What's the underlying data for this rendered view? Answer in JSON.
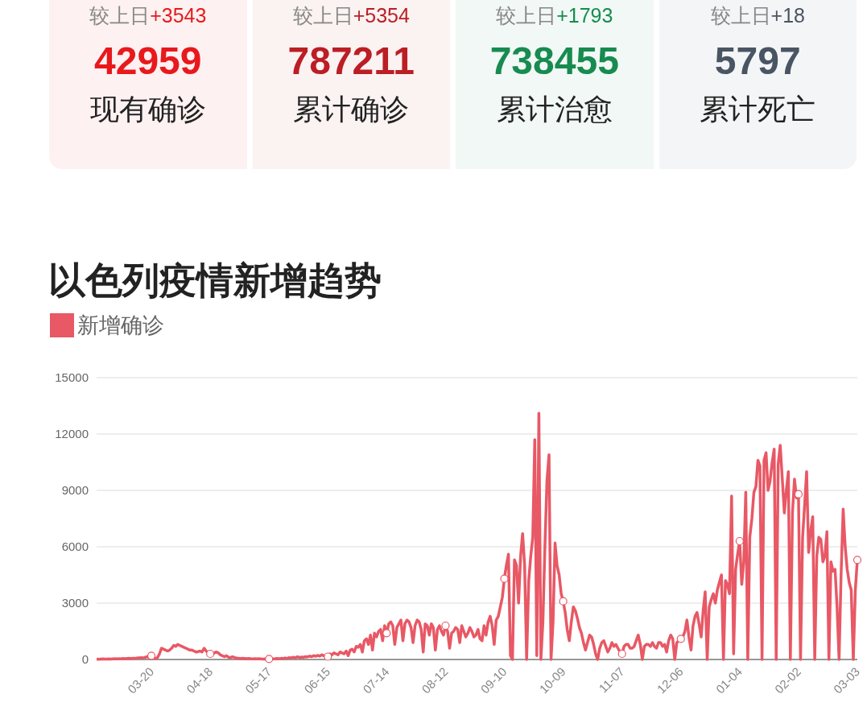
{
  "stats": [
    {
      "change_label": "较上日",
      "change": "+3543",
      "value": "42959",
      "label": "现有确诊",
      "color": "#e8191c"
    },
    {
      "change_label": "较上日",
      "change": "+5354",
      "value": "787211",
      "label": "累计确诊",
      "color": "#bb1e24"
    },
    {
      "change_label": "较上日",
      "change": "+1793",
      "value": "738455",
      "label": "累计治愈",
      "color": "#178b50"
    },
    {
      "change_label": "较上日",
      "change": "+18",
      "value": "5797",
      "label": "累计死亡",
      "color": "#4a5563"
    }
  ],
  "trend": {
    "title": "以色列疫情新增趋势",
    "chart_data": {
      "type": "line",
      "categories": [
        null,
        null,
        null,
        null,
        null,
        null,
        null,
        null,
        null,
        null,
        null,
        null,
        null,
        null,
        null,
        null,
        null,
        null,
        null,
        null,
        null,
        null,
        null,
        null,
        null,
        null,
        null,
        "03-20",
        null,
        null,
        null,
        null,
        null,
        null,
        null,
        null,
        null,
        null,
        null,
        null,
        null,
        null,
        null,
        null,
        null,
        null,
        null,
        null,
        null,
        null,
        null,
        null,
        null,
        null,
        null,
        null,
        "04-18",
        null,
        null,
        null,
        null,
        null,
        null,
        null,
        null,
        null,
        null,
        null,
        null,
        null,
        null,
        null,
        null,
        null,
        null,
        null,
        null,
        null,
        null,
        null,
        null,
        null,
        null,
        null,
        null,
        "05-17",
        null,
        null,
        null,
        null,
        null,
        null,
        null,
        null,
        null,
        null,
        null,
        null,
        null,
        null,
        null,
        null,
        null,
        null,
        null,
        null,
        null,
        null,
        null,
        null,
        null,
        null,
        null,
        null,
        "06-15",
        null,
        null,
        null,
        null,
        null,
        null,
        null,
        null,
        null,
        null,
        null,
        null,
        null,
        null,
        null,
        null,
        null,
        null,
        null,
        null,
        null,
        null,
        null,
        null,
        null,
        null,
        null,
        null,
        "07-14",
        null,
        null,
        null,
        null,
        null,
        null,
        null,
        null,
        null,
        null,
        null,
        null,
        null,
        null,
        null,
        null,
        null,
        null,
        null,
        null,
        null,
        null,
        null,
        null,
        null,
        null,
        null,
        null,
        "08-12",
        null,
        null,
        null,
        null,
        null,
        null,
        null,
        null,
        null,
        null,
        null,
        null,
        null,
        null,
        null,
        null,
        null,
        null,
        null,
        null,
        null,
        null,
        null,
        null,
        null,
        null,
        null,
        null,
        "09-10",
        null,
        null,
        null,
        null,
        null,
        null,
        null,
        null,
        null,
        null,
        null,
        null,
        null,
        null,
        null,
        null,
        null,
        null,
        null,
        null,
        null,
        null,
        null,
        null,
        null,
        null,
        null,
        null,
        "10-09",
        null,
        null,
        null,
        null,
        null,
        null,
        null,
        null,
        null,
        null,
        null,
        null,
        null,
        null,
        null,
        null,
        null,
        null,
        null,
        null,
        null,
        null,
        null,
        null,
        null,
        null,
        null,
        null,
        "11-07",
        null,
        null,
        null,
        null,
        null,
        null,
        null,
        null,
        null,
        null,
        null,
        null,
        null,
        null,
        null,
        null,
        null,
        null,
        null,
        null,
        null,
        null,
        null,
        null,
        null,
        null,
        null,
        null,
        "12-06",
        null,
        null,
        null,
        null,
        null,
        null,
        null,
        null,
        null,
        null,
        null,
        null,
        null,
        null,
        null,
        null,
        null,
        null,
        null,
        null,
        null,
        null,
        null,
        null,
        null,
        null,
        null,
        null,
        "01-04",
        null,
        null,
        null,
        null,
        null,
        null,
        null,
        null,
        null,
        null,
        null,
        null,
        null,
        null,
        null,
        null,
        null,
        null,
        null,
        null,
        null,
        null,
        null,
        null,
        null,
        null,
        null,
        null,
        "02-02",
        null,
        null,
        null,
        null,
        null,
        null,
        null,
        null,
        null,
        null,
        null,
        null,
        null,
        null,
        null,
        null,
        null,
        null,
        null,
        null,
        null,
        null,
        null,
        null,
        null,
        null,
        null,
        null,
        "03-03"
      ],
      "series": [
        {
          "name": "新增确诊",
          "color": "#e85865",
          "values": [
            20,
            10,
            20,
            30,
            20,
            20,
            30,
            20,
            30,
            40,
            30,
            40,
            30,
            50,
            40,
            50,
            60,
            50,
            70,
            60,
            80,
            90,
            100,
            80,
            120,
            150,
            100,
            200,
            100,
            50,
            100,
            300,
            600,
            550,
            500,
            450,
            500,
            600,
            750,
            700,
            800,
            750,
            700,
            650,
            600,
            550,
            500,
            500,
            450,
            400,
            420,
            450,
            400,
            600,
            450,
            350,
            300,
            300,
            350,
            400,
            350,
            250,
            200,
            150,
            200,
            120,
            100,
            150,
            100,
            80,
            60,
            50,
            60,
            50,
            40,
            50,
            40,
            30,
            40,
            30,
            40,
            30,
            20,
            30,
            20,
            30,
            20,
            30,
            40,
            50,
            40,
            60,
            50,
            80,
            60,
            100,
            80,
            120,
            90,
            150,
            100,
            130,
            120,
            150,
            140,
            180,
            150,
            200,
            170,
            220,
            180,
            250,
            200,
            180,
            150,
            300,
            250,
            350,
            300,
            250,
            400,
            350,
            300,
            450,
            200,
            500,
            550,
            400,
            700,
            650,
            800,
            400,
            1000,
            1100,
            800,
            1300,
            500,
            1400,
            1200,
            1500,
            1600,
            1000,
            1800,
            1400,
            1900,
            2000,
            1800,
            800,
            1700,
            1900,
            2100,
            1000,
            1900,
            2100,
            2000,
            1700,
            900,
            1800,
            2100,
            2000,
            1600,
            400,
            1900,
            1800,
            1300,
            1900,
            1700,
            500,
            1600,
            1800,
            1500,
            1300,
            1800,
            1500,
            600,
            1400,
            1500,
            1700,
            1600,
            900,
            1800,
            1500,
            1200,
            1400,
            1700,
            1500,
            1200,
            1300,
            1600,
            1100,
            1000,
            1800,
            1300,
            2000,
            2300,
            1800,
            800,
            2100,
            2300,
            2800,
            3300,
            4300,
            5000,
            5600,
            200,
            0,
            5300,
            5000,
            3000,
            5500,
            6700,
            5000,
            0,
            4200,
            5500,
            6500,
            11700,
            200,
            13100,
            0,
            2000,
            6000,
            9500,
            10900,
            0,
            2000,
            6200,
            5000,
            4500,
            3500,
            3100,
            2500,
            1600,
            1000,
            2000,
            2800,
            2600,
            2200,
            1700,
            1400,
            900,
            500,
            900,
            1300,
            1200,
            800,
            300,
            0,
            600,
            900,
            1000,
            700,
            400,
            600,
            900,
            700,
            800,
            600,
            400,
            300,
            700,
            800,
            800,
            600,
            600,
            700,
            1000,
            1300,
            800,
            0,
            700,
            800,
            800,
            700,
            900,
            700,
            600,
            900,
            900,
            700,
            800,
            400,
            1000,
            1300,
            1100,
            0,
            900,
            1000,
            1100,
            1200,
            1500,
            2100,
            1200,
            500,
            1800,
            2300,
            2500,
            1900,
            1200,
            2600,
            3600,
            0,
            2800,
            3200,
            3500,
            3000,
            3700,
            4100,
            4500,
            0,
            4200,
            4000,
            3500,
            8700,
            300,
            4800,
            5600,
            6300,
            4000,
            5200,
            8900,
            0,
            6500,
            7500,
            8900,
            9200,
            10600,
            10300,
            0,
            10600,
            11000,
            9000,
            9500,
            10500,
            11200,
            0,
            10400,
            11400,
            9600,
            7800,
            9000,
            10000,
            0,
            7800,
            9600,
            8600,
            8800,
            0,
            6500,
            8200,
            10000,
            5700,
            6800,
            7600,
            0,
            5500,
            6500,
            6400,
            5200,
            5500,
            6800,
            0,
            5200,
            4700,
            4800,
            2800,
            0,
            4500,
            8000,
            6000,
            4800,
            4100,
            3700,
            0,
            3700,
            5300
          ]
        }
      ],
      "grid": true,
      "ylim": [
        0,
        15000
      ],
      "yticks": [
        0,
        3000,
        6000,
        9000,
        12000,
        15000
      ]
    }
  }
}
